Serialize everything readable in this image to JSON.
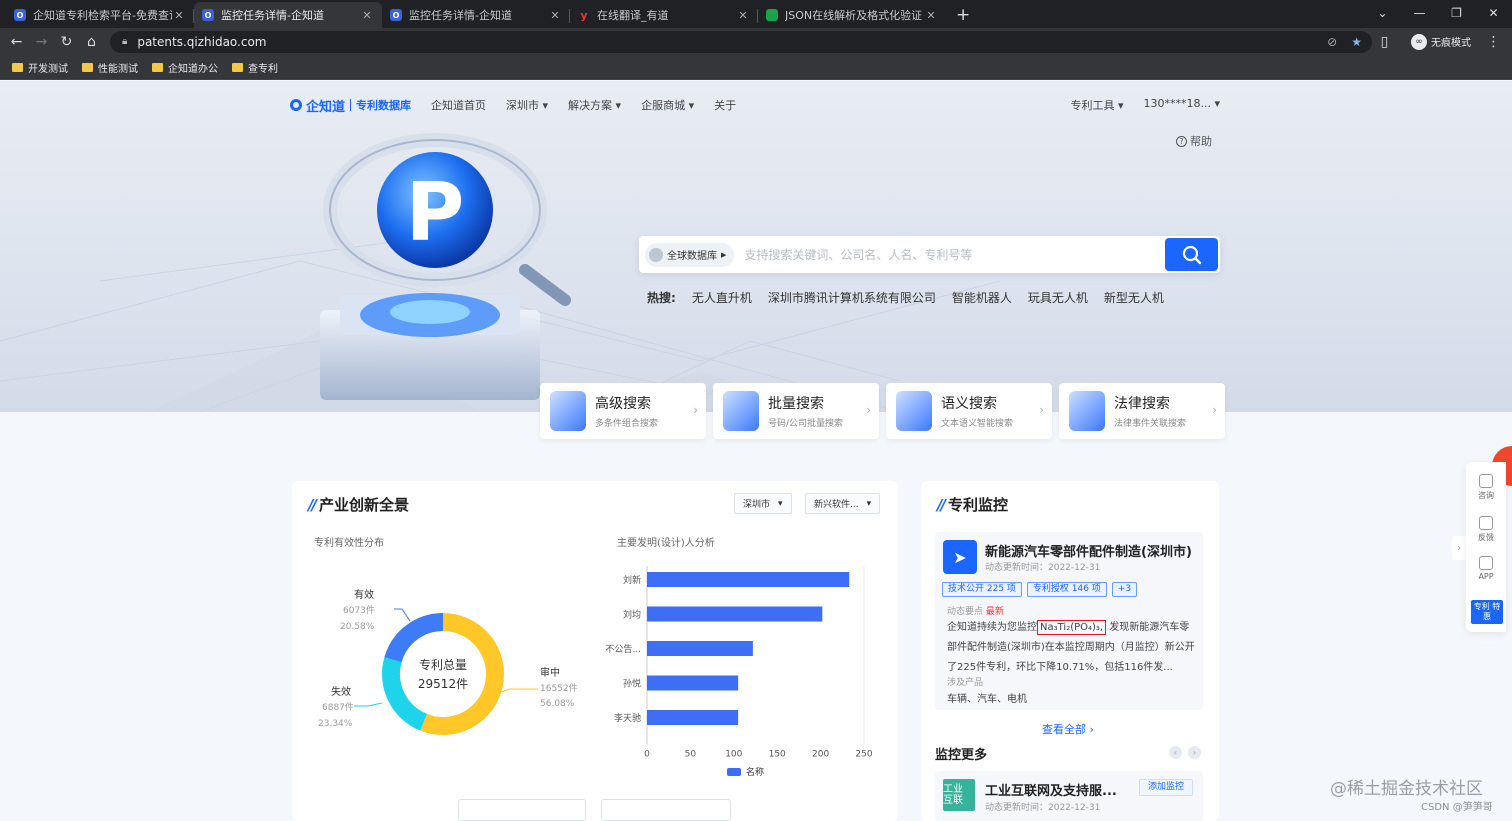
{
  "browser": {
    "tabs": [
      {
        "title": "企知道专利检索平台-免费查询专",
        "active": false
      },
      {
        "title": "监控任务详情-企知道",
        "active": true
      },
      {
        "title": "监控任务详情-企知道",
        "active": false
      },
      {
        "title": "在线翻译_有道",
        "active": false
      },
      {
        "title": "JSON在线解析及格式化验证 - JS",
        "active": false
      }
    ],
    "url": "patents.qizhidao.com",
    "incognito_label": "无痕模式",
    "bookmarks": [
      "开发测试",
      "性能测试",
      "企知道办公",
      "查专利"
    ]
  },
  "nav": {
    "logo": "企知道",
    "logo_sub": "专利数据库",
    "items": [
      "企知道首页",
      "深圳市 ▾",
      "解决方案 ▾",
      "企服商城 ▾",
      "关于"
    ],
    "right": [
      "专利工具 ▾",
      "130****18... ▾"
    ],
    "help": "帮助"
  },
  "search": {
    "db_label": "全球数据库",
    "placeholder": "支持搜索关键词、公司名、人名、专利号等",
    "hot_label": "热搜:",
    "hot": [
      "无人直升机",
      "深圳市腾讯计算机系统有限公司",
      "智能机器人",
      "玩具无人机",
      "新型无人机"
    ]
  },
  "features": [
    {
      "title": "高级搜索",
      "sub": "多条件组合搜索"
    },
    {
      "title": "批量搜索",
      "sub": "号码/公司批量搜索"
    },
    {
      "title": "语义搜索",
      "sub": "文本语义智能搜索"
    },
    {
      "title": "法律搜索",
      "sub": "法律事件关联搜索"
    }
  ],
  "industry": {
    "title": "产业创新全景",
    "filters": [
      "深圳市",
      "新兴软件..."
    ],
    "donut_title": "专利有效性分布",
    "bar_title": "主要发明(设计)人分析",
    "donut_center_label": "专利总量",
    "donut_center_value": "29512件",
    "segments": [
      {
        "name": "有效",
        "count": "6073件",
        "pct": "20.58%",
        "value": 6073,
        "color": "#3d7bf7"
      },
      {
        "name": "审中",
        "count": "16552件",
        "pct": "56.08%",
        "value": 16552,
        "color": "#ffc727"
      },
      {
        "name": "失效",
        "count": "6887件",
        "pct": "23.34%",
        "value": 6887,
        "color": "#1fd3ea"
      }
    ]
  },
  "chart_data": {
    "type": "bar",
    "orientation": "horizontal",
    "title": "主要发明(设计)人分析",
    "categories": [
      "刘新",
      "刘均",
      "不公告...",
      "孙悦",
      "李天驰"
    ],
    "series": [
      {
        "name": "名称",
        "values": [
          233,
          202,
          122,
          105,
          105
        ],
        "color": "#3d6ef5"
      }
    ],
    "xlim": [
      0,
      250
    ],
    "xticks": [
      "0",
      "50",
      "100",
      "150",
      "200",
      "250"
    ],
    "legend": "bottom",
    "grid": false
  },
  "monitor": {
    "title": "专利监控",
    "card_title": "新能源汽车零部件配件制造(深圳市)",
    "card_date": "动态更新时间：2022-12-31",
    "tags": [
      "技术公开 225 项",
      "专利授权 146 项",
      "+3"
    ],
    "key_label": "动态要点",
    "key_new": "最新",
    "body_pre": "企知道持续为您监控",
    "body_hl": "Na₃Ti₂(PO₄)₃,",
    "body_post": "发现新能源汽车零部件配件制造(深圳市)在本监控周期内（月监控）新公开了225件专利，环比下降10.71%，包括116件发...",
    "products_label": "涉及产品",
    "products": "车辆、汽车、电机",
    "view_all": "查看全部 ›",
    "more_title": "监控更多",
    "more_card_title": "工业互联网及支持服...",
    "more_card_icon": "工业 互联",
    "more_card_date": "动态更新时间：2022-12-31",
    "add_btn": "添加监控"
  },
  "float": {
    "items": [
      "咨询",
      "反馈",
      "APP"
    ],
    "badge": "专利 特惠"
  },
  "watermark": "@稀土掘金技术社区",
  "watermark2": "CSDN @笋笋哥"
}
